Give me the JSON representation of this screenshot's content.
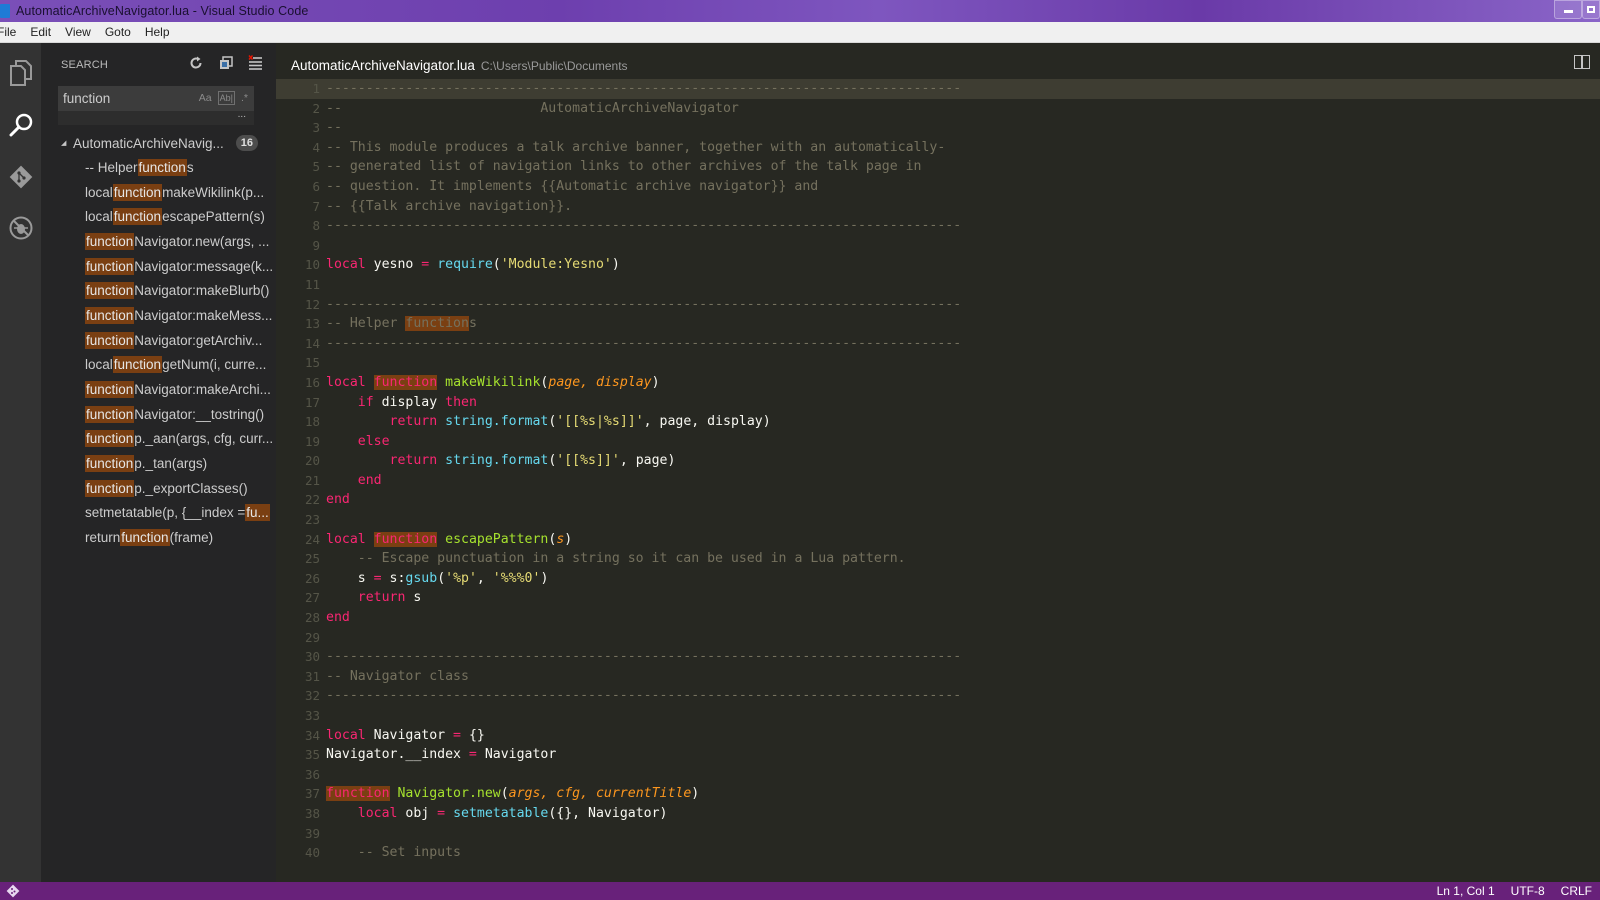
{
  "window": {
    "title": "AutomaticArchiveNavigator.lua - Visual Studio Code"
  },
  "menu": [
    "File",
    "Edit",
    "View",
    "Goto",
    "Help"
  ],
  "activity_bar": [
    "explorer-icon",
    "search-icon",
    "git-icon",
    "debug-icon"
  ],
  "sidebar": {
    "header": "SEARCH",
    "actions": [
      "refresh-icon",
      "collapse-all-icon",
      "clear-results-icon"
    ],
    "search": {
      "value": "function",
      "options": [
        "Aa",
        "Ab|",
        ".*"
      ],
      "more": "..."
    },
    "file": {
      "name": "AutomaticArchiveNavig...",
      "count": "16"
    },
    "matches": [
      {
        "pre": "-- Helper ",
        "hit": "function",
        "post": "s"
      },
      {
        "pre": "local ",
        "hit": "function",
        "post": " makeWikilink(p..."
      },
      {
        "pre": "local ",
        "hit": "function",
        "post": " escapePattern(s)"
      },
      {
        "pre": "",
        "hit": "function",
        "post": " Navigator.new(args, ..."
      },
      {
        "pre": "",
        "hit": "function",
        "post": " Navigator:message(k..."
      },
      {
        "pre": "",
        "hit": "function",
        "post": " Navigator:makeBlurb()"
      },
      {
        "pre": "",
        "hit": "function",
        "post": " Navigator:makeMess..."
      },
      {
        "pre": "",
        "hit": "function",
        "post": " Navigator:getArchiv..."
      },
      {
        "pre": "local ",
        "hit": "function",
        "post": " getNum(i, curre..."
      },
      {
        "pre": "",
        "hit": "function",
        "post": " Navigator:makeArchi..."
      },
      {
        "pre": "",
        "hit": "function",
        "post": " Navigator:__tostring()"
      },
      {
        "pre": "",
        "hit": "function",
        "post": " p._aan(args, cfg, curr..."
      },
      {
        "pre": "",
        "hit": "function",
        "post": " p._tan(args)"
      },
      {
        "pre": "",
        "hit": "function",
        "post": " p._exportClasses()"
      },
      {
        "pre": "setmetatable(p, {__index = ",
        "hit": "fu...",
        "post": ""
      },
      {
        "pre": "return ",
        "hit": "function",
        "post": "(frame)"
      }
    ]
  },
  "editor": {
    "file_name": "AutomaticArchiveNavigator.lua",
    "file_path": "C:\\Users\\Public\\Documents",
    "current_line": 1,
    "lines": [
      [
        [
          "c",
          "--------------------------------------------------------------------------------"
        ]
      ],
      [
        [
          "c",
          "--                         AutomaticArchiveNavigator"
        ]
      ],
      [
        [
          "c",
          "--"
        ]
      ],
      [
        [
          "c",
          "-- This module produces a talk archive banner, together with an automatically-"
        ]
      ],
      [
        [
          "c",
          "-- generated list of navigation links to other archives of the talk page in"
        ]
      ],
      [
        [
          "c",
          "-- question. It implements {{Automatic archive navigator}} and"
        ]
      ],
      [
        [
          "c",
          "-- {{Talk archive navigation}}."
        ]
      ],
      [
        [
          "c",
          "--------------------------------------------------------------------------------"
        ]
      ],
      [],
      [
        [
          "k",
          "local"
        ],
        [
          "t",
          " yesno "
        ],
        [
          "o",
          "="
        ],
        [
          "t",
          " "
        ],
        [
          "b",
          "require"
        ],
        [
          "t",
          "("
        ],
        [
          "s",
          "'Module:Yesno'"
        ],
        [
          "t",
          ")"
        ]
      ],
      [],
      [
        [
          "c",
          "--------------------------------------------------------------------------------"
        ]
      ],
      [
        [
          "c",
          "-- Helper "
        ],
        [
          "cm",
          "function"
        ],
        [
          "c",
          "s"
        ]
      ],
      [
        [
          "c",
          "--------------------------------------------------------------------------------"
        ]
      ],
      [],
      [
        [
          "k",
          "local"
        ],
        [
          "t",
          " "
        ],
        [
          "mk",
          "function"
        ],
        [
          "t",
          " "
        ],
        [
          "f",
          "makeWikilink"
        ],
        [
          "t",
          "("
        ],
        [
          "p",
          "page, display"
        ],
        [
          "t",
          ")"
        ]
      ],
      [
        [
          "t",
          "    "
        ],
        [
          "k",
          "if"
        ],
        [
          "t",
          " display "
        ],
        [
          "k",
          "then"
        ]
      ],
      [
        [
          "t",
          "        "
        ],
        [
          "k",
          "return"
        ],
        [
          "t",
          " "
        ],
        [
          "b",
          "string.format"
        ],
        [
          "t",
          "("
        ],
        [
          "s",
          "'[[%s|%s]]'"
        ],
        [
          "t",
          ", page, display)"
        ]
      ],
      [
        [
          "t",
          "    "
        ],
        [
          "k",
          "else"
        ]
      ],
      [
        [
          "t",
          "        "
        ],
        [
          "k",
          "return"
        ],
        [
          "t",
          " "
        ],
        [
          "b",
          "string.format"
        ],
        [
          "t",
          "("
        ],
        [
          "s",
          "'[[%s]]'"
        ],
        [
          "t",
          ", page)"
        ]
      ],
      [
        [
          "t",
          "    "
        ],
        [
          "k",
          "end"
        ]
      ],
      [
        [
          "k",
          "end"
        ]
      ],
      [],
      [
        [
          "k",
          "local"
        ],
        [
          "t",
          " "
        ],
        [
          "mk",
          "function"
        ],
        [
          "t",
          " "
        ],
        [
          "f",
          "escapePattern"
        ],
        [
          "t",
          "("
        ],
        [
          "p",
          "s"
        ],
        [
          "t",
          ")"
        ]
      ],
      [
        [
          "t",
          "    "
        ],
        [
          "c",
          "-- Escape punctuation in a string so it can be used in a Lua pattern."
        ]
      ],
      [
        [
          "t",
          "    s "
        ],
        [
          "o",
          "="
        ],
        [
          "t",
          " s:"
        ],
        [
          "b",
          "gsub"
        ],
        [
          "t",
          "("
        ],
        [
          "s",
          "'%p'"
        ],
        [
          "t",
          ", "
        ],
        [
          "s",
          "'%%%0'"
        ],
        [
          "t",
          ")"
        ]
      ],
      [
        [
          "t",
          "    "
        ],
        [
          "k",
          "return"
        ],
        [
          "t",
          " s"
        ]
      ],
      [
        [
          "k",
          "end"
        ]
      ],
      [],
      [
        [
          "c",
          "--------------------------------------------------------------------------------"
        ]
      ],
      [
        [
          "c",
          "-- Navigator class"
        ]
      ],
      [
        [
          "c",
          "--------------------------------------------------------------------------------"
        ]
      ],
      [],
      [
        [
          "k",
          "local"
        ],
        [
          "t",
          " Navigator "
        ],
        [
          "o",
          "="
        ],
        [
          "t",
          " {}"
        ]
      ],
      [
        [
          "t",
          "Navigator.__index "
        ],
        [
          "o",
          "="
        ],
        [
          "t",
          " Navigator"
        ]
      ],
      [],
      [
        [
          "mk",
          "function"
        ],
        [
          "t",
          " "
        ],
        [
          "f",
          "Navigator.new"
        ],
        [
          "t",
          "("
        ],
        [
          "p",
          "args, cfg, currentTitle"
        ],
        [
          "t",
          ")"
        ]
      ],
      [
        [
          "t",
          "    "
        ],
        [
          "k",
          "local"
        ],
        [
          "t",
          " obj "
        ],
        [
          "o",
          "="
        ],
        [
          "t",
          " "
        ],
        [
          "b",
          "setmetatable"
        ],
        [
          "t",
          "({}, Navigator)"
        ]
      ],
      [],
      [
        [
          "t",
          "    "
        ],
        [
          "c",
          "-- Set inputs"
        ]
      ]
    ]
  },
  "status_bar": {
    "git_icon": "git-branch-icon",
    "position": "Ln 1, Col 1",
    "encoding": "UTF-8",
    "line_ending": "CRLF"
  },
  "colors": {
    "status_bar": "#68217a",
    "title_bar": "#6d3fae",
    "match_highlight": "#7a3f12",
    "editor_bg": "#272822"
  }
}
